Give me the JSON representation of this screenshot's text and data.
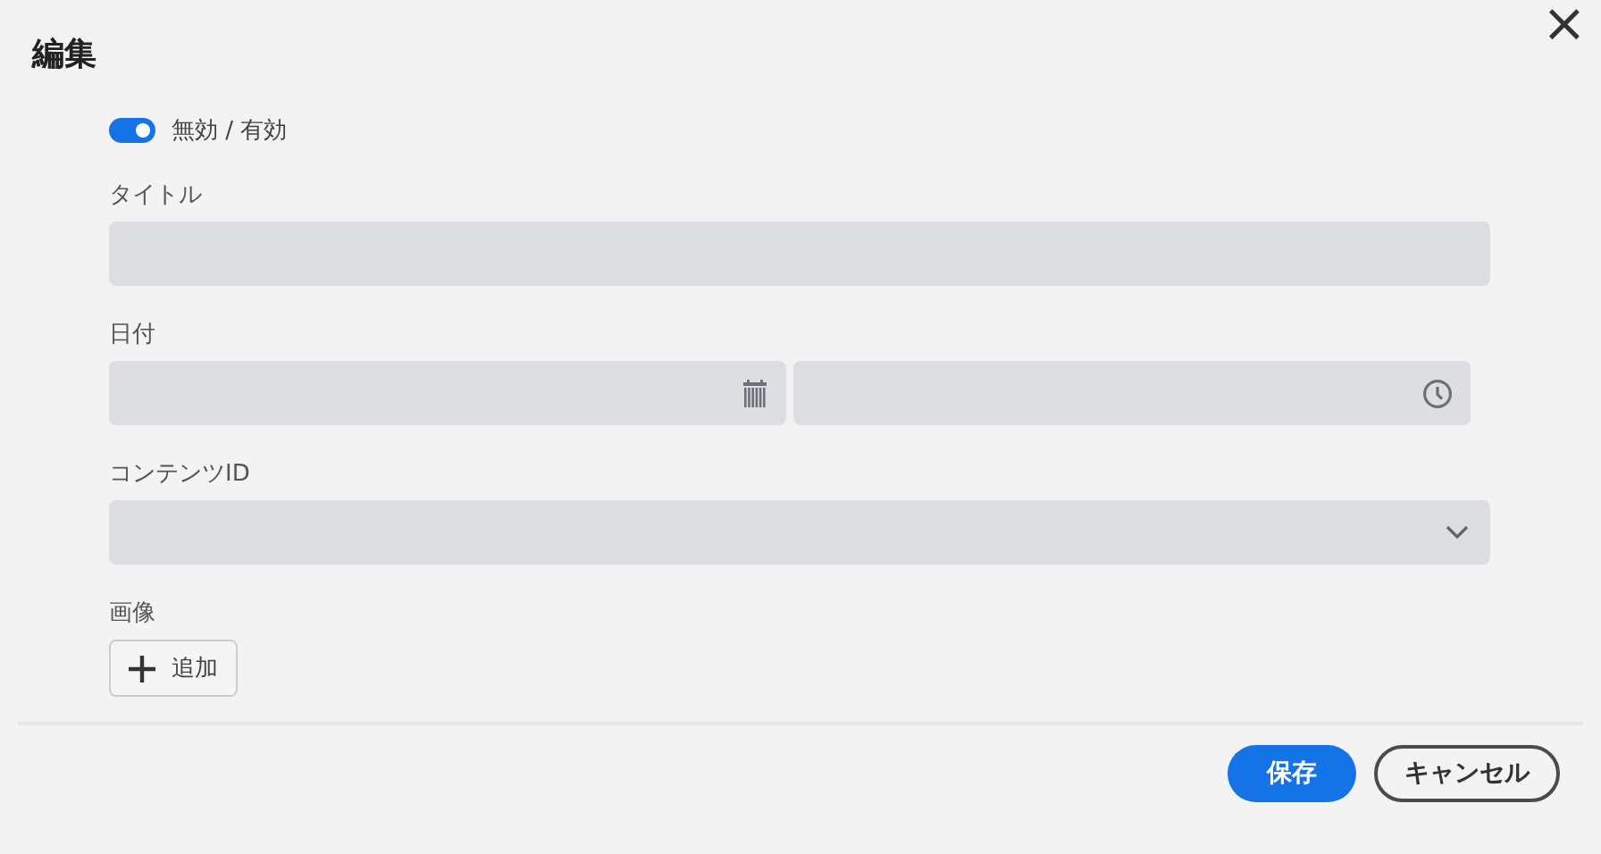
{
  "dialog": {
    "title": "編集",
    "close": "×"
  },
  "toggle": {
    "label": "無効 / 有効",
    "on": true
  },
  "fields": [
    {
      "label": "タイトル",
      "kind": "text"
    },
    {
      "label": "日付",
      "kind": "datetime"
    },
    {
      "label": "コンテンツID",
      "kind": "select"
    },
    {
      "label": "画像",
      "kind": "upload",
      "button": "追加"
    }
  ],
  "buttons": [
    {
      "label": "保存",
      "kind": "primary"
    },
    {
      "label": "キャンセル",
      "kind": "secondary"
    }
  ]
}
